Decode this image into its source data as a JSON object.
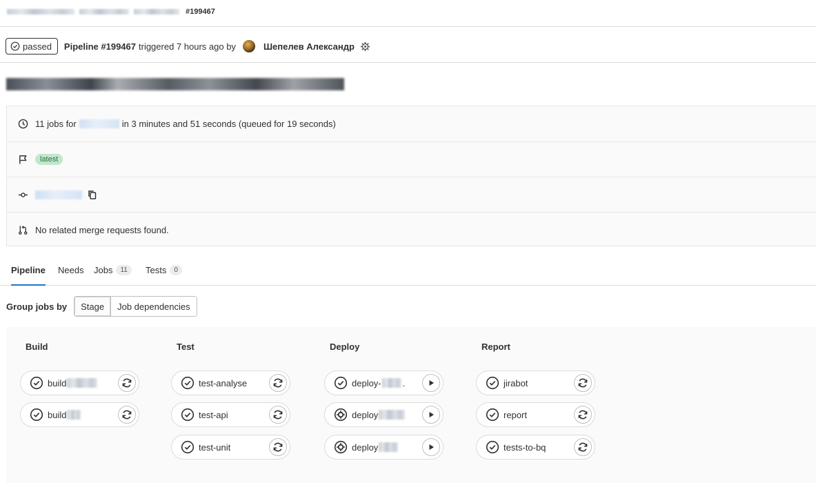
{
  "breadcrumb": {
    "pipeline_id": "#199467"
  },
  "header": {
    "status": "passed",
    "pipeline_label": "Pipeline #199467",
    "triggered_text": "triggered 7 hours ago by",
    "author": "Шепелев Александр"
  },
  "info": {
    "jobs_prefix": "11 jobs for",
    "jobs_suffix": "in 3 minutes and 51 seconds (queued for 19 seconds)",
    "badge": "latest",
    "merge_requests": "No related merge requests found."
  },
  "tabs": [
    {
      "label": "Pipeline",
      "active": true
    },
    {
      "label": "Needs"
    },
    {
      "label": "Jobs",
      "count": "11"
    },
    {
      "label": "Tests",
      "count": "0"
    }
  ],
  "group_by": {
    "label": "Group jobs by",
    "options": [
      "Stage",
      "Job dependencies"
    ],
    "selected": "Stage"
  },
  "stages": [
    {
      "name": "Build",
      "jobs": [
        {
          "name": "build",
          "status": "passed",
          "action": "retry"
        },
        {
          "name": "build",
          "status": "passed",
          "action": "retry"
        }
      ]
    },
    {
      "name": "Test",
      "jobs": [
        {
          "name": "test-analyse",
          "status": "passed",
          "action": "retry"
        },
        {
          "name": "test-api",
          "status": "passed",
          "action": "retry"
        },
        {
          "name": "test-unit",
          "status": "passed",
          "action": "retry"
        }
      ]
    },
    {
      "name": "Deploy",
      "jobs": [
        {
          "name": "deploy-",
          "suffix": ".",
          "status": "passed",
          "action": "play"
        },
        {
          "name": "deploy",
          "status": "manual",
          "action": "play"
        },
        {
          "name": "deploy",
          "status": "manual",
          "action": "play"
        }
      ]
    },
    {
      "name": "Report",
      "jobs": [
        {
          "name": "jirabot",
          "status": "passed",
          "action": "retry"
        },
        {
          "name": "report",
          "status": "passed",
          "action": "retry"
        },
        {
          "name": "tests-to-bq",
          "status": "passed",
          "action": "retry"
        }
      ]
    }
  ],
  "icons": {
    "status_passed": "check-circle-icon",
    "status_manual": "gear-icon",
    "action_retry": "retry-icon",
    "action_play": "play-icon"
  },
  "colors": {
    "latest_bg": "#c3e6cd",
    "latest_text": "#217645",
    "active_tab": "#1f75cb"
  }
}
